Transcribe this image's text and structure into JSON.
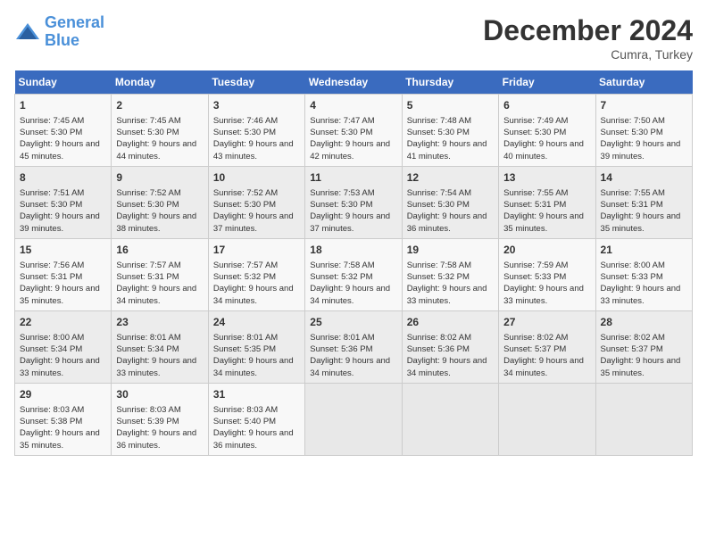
{
  "header": {
    "logo_line1": "General",
    "logo_line2": "Blue",
    "month": "December 2024",
    "location": "Cumra, Turkey"
  },
  "weekdays": [
    "Sunday",
    "Monday",
    "Tuesday",
    "Wednesday",
    "Thursday",
    "Friday",
    "Saturday"
  ],
  "weeks": [
    [
      {
        "day": "1",
        "sunrise": "Sunrise: 7:45 AM",
        "sunset": "Sunset: 5:30 PM",
        "daylight": "Daylight: 9 hours and 45 minutes."
      },
      {
        "day": "2",
        "sunrise": "Sunrise: 7:45 AM",
        "sunset": "Sunset: 5:30 PM",
        "daylight": "Daylight: 9 hours and 44 minutes."
      },
      {
        "day": "3",
        "sunrise": "Sunrise: 7:46 AM",
        "sunset": "Sunset: 5:30 PM",
        "daylight": "Daylight: 9 hours and 43 minutes."
      },
      {
        "day": "4",
        "sunrise": "Sunrise: 7:47 AM",
        "sunset": "Sunset: 5:30 PM",
        "daylight": "Daylight: 9 hours and 42 minutes."
      },
      {
        "day": "5",
        "sunrise": "Sunrise: 7:48 AM",
        "sunset": "Sunset: 5:30 PM",
        "daylight": "Daylight: 9 hours and 41 minutes."
      },
      {
        "day": "6",
        "sunrise": "Sunrise: 7:49 AM",
        "sunset": "Sunset: 5:30 PM",
        "daylight": "Daylight: 9 hours and 40 minutes."
      },
      {
        "day": "7",
        "sunrise": "Sunrise: 7:50 AM",
        "sunset": "Sunset: 5:30 PM",
        "daylight": "Daylight: 9 hours and 39 minutes."
      }
    ],
    [
      {
        "day": "8",
        "sunrise": "Sunrise: 7:51 AM",
        "sunset": "Sunset: 5:30 PM",
        "daylight": "Daylight: 9 hours and 39 minutes."
      },
      {
        "day": "9",
        "sunrise": "Sunrise: 7:52 AM",
        "sunset": "Sunset: 5:30 PM",
        "daylight": "Daylight: 9 hours and 38 minutes."
      },
      {
        "day": "10",
        "sunrise": "Sunrise: 7:52 AM",
        "sunset": "Sunset: 5:30 PM",
        "daylight": "Daylight: 9 hours and 37 minutes."
      },
      {
        "day": "11",
        "sunrise": "Sunrise: 7:53 AM",
        "sunset": "Sunset: 5:30 PM",
        "daylight": "Daylight: 9 hours and 37 minutes."
      },
      {
        "day": "12",
        "sunrise": "Sunrise: 7:54 AM",
        "sunset": "Sunset: 5:30 PM",
        "daylight": "Daylight: 9 hours and 36 minutes."
      },
      {
        "day": "13",
        "sunrise": "Sunrise: 7:55 AM",
        "sunset": "Sunset: 5:31 PM",
        "daylight": "Daylight: 9 hours and 35 minutes."
      },
      {
        "day": "14",
        "sunrise": "Sunrise: 7:55 AM",
        "sunset": "Sunset: 5:31 PM",
        "daylight": "Daylight: 9 hours and 35 minutes."
      }
    ],
    [
      {
        "day": "15",
        "sunrise": "Sunrise: 7:56 AM",
        "sunset": "Sunset: 5:31 PM",
        "daylight": "Daylight: 9 hours and 35 minutes."
      },
      {
        "day": "16",
        "sunrise": "Sunrise: 7:57 AM",
        "sunset": "Sunset: 5:31 PM",
        "daylight": "Daylight: 9 hours and 34 minutes."
      },
      {
        "day": "17",
        "sunrise": "Sunrise: 7:57 AM",
        "sunset": "Sunset: 5:32 PM",
        "daylight": "Daylight: 9 hours and 34 minutes."
      },
      {
        "day": "18",
        "sunrise": "Sunrise: 7:58 AM",
        "sunset": "Sunset: 5:32 PM",
        "daylight": "Daylight: 9 hours and 34 minutes."
      },
      {
        "day": "19",
        "sunrise": "Sunrise: 7:58 AM",
        "sunset": "Sunset: 5:32 PM",
        "daylight": "Daylight: 9 hours and 33 minutes."
      },
      {
        "day": "20",
        "sunrise": "Sunrise: 7:59 AM",
        "sunset": "Sunset: 5:33 PM",
        "daylight": "Daylight: 9 hours and 33 minutes."
      },
      {
        "day": "21",
        "sunrise": "Sunrise: 8:00 AM",
        "sunset": "Sunset: 5:33 PM",
        "daylight": "Daylight: 9 hours and 33 minutes."
      }
    ],
    [
      {
        "day": "22",
        "sunrise": "Sunrise: 8:00 AM",
        "sunset": "Sunset: 5:34 PM",
        "daylight": "Daylight: 9 hours and 33 minutes."
      },
      {
        "day": "23",
        "sunrise": "Sunrise: 8:01 AM",
        "sunset": "Sunset: 5:34 PM",
        "daylight": "Daylight: 9 hours and 33 minutes."
      },
      {
        "day": "24",
        "sunrise": "Sunrise: 8:01 AM",
        "sunset": "Sunset: 5:35 PM",
        "daylight": "Daylight: 9 hours and 34 minutes."
      },
      {
        "day": "25",
        "sunrise": "Sunrise: 8:01 AM",
        "sunset": "Sunset: 5:36 PM",
        "daylight": "Daylight: 9 hours and 34 minutes."
      },
      {
        "day": "26",
        "sunrise": "Sunrise: 8:02 AM",
        "sunset": "Sunset: 5:36 PM",
        "daylight": "Daylight: 9 hours and 34 minutes."
      },
      {
        "day": "27",
        "sunrise": "Sunrise: 8:02 AM",
        "sunset": "Sunset: 5:37 PM",
        "daylight": "Daylight: 9 hours and 34 minutes."
      },
      {
        "day": "28",
        "sunrise": "Sunrise: 8:02 AM",
        "sunset": "Sunset: 5:37 PM",
        "daylight": "Daylight: 9 hours and 35 minutes."
      }
    ],
    [
      {
        "day": "29",
        "sunrise": "Sunrise: 8:03 AM",
        "sunset": "Sunset: 5:38 PM",
        "daylight": "Daylight: 9 hours and 35 minutes."
      },
      {
        "day": "30",
        "sunrise": "Sunrise: 8:03 AM",
        "sunset": "Sunset: 5:39 PM",
        "daylight": "Daylight: 9 hours and 36 minutes."
      },
      {
        "day": "31",
        "sunrise": "Sunrise: 8:03 AM",
        "sunset": "Sunset: 5:40 PM",
        "daylight": "Daylight: 9 hours and 36 minutes."
      },
      null,
      null,
      null,
      null
    ]
  ]
}
